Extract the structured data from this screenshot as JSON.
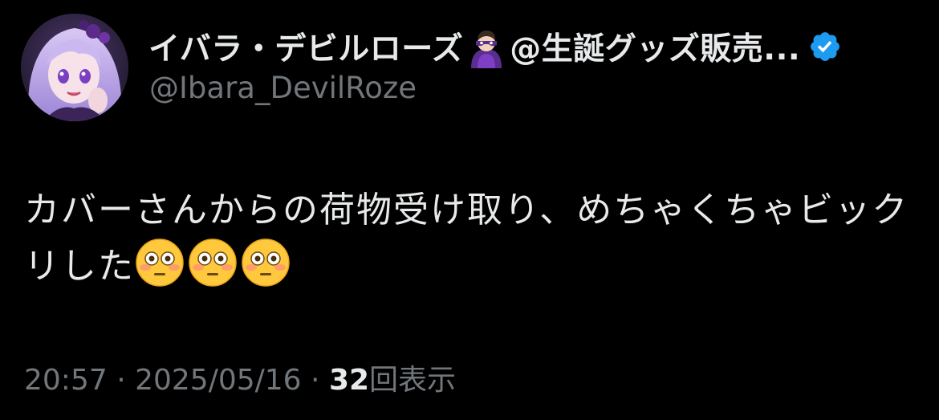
{
  "author": {
    "display_name_part1": "イバラ・デビルローズ",
    "display_name_part2": "@生誕グッズ販売...",
    "handle": "@Ibara_DevilRoze",
    "verified": true,
    "name_emoji": "masked-superhero-emoji",
    "avatar": "purple-haired-anime-girl-avatar"
  },
  "tweet": {
    "text": "カバーさんからの荷物受け取り、めちゃくちゃビックリした",
    "emojis": [
      "flushed-face-emoji",
      "flushed-face-emoji",
      "flushed-face-emoji"
    ]
  },
  "meta": {
    "time": "20:57",
    "separator1": " · ",
    "date": "2025/05/16",
    "separator2": " · ",
    "views_count": "32",
    "views_label": "回表示"
  },
  "colors": {
    "background": "#000000",
    "primary_text": "#e7e9ea",
    "secondary_text": "#71767b",
    "verified_blue": "#1d9bf0"
  }
}
